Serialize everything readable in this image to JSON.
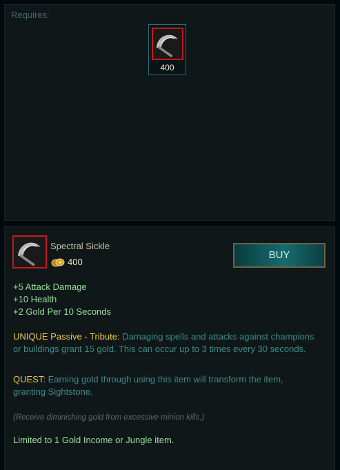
{
  "requires": {
    "label": "Requires:",
    "item": {
      "price": "400"
    }
  },
  "item": {
    "name": "Spectral Sickle",
    "cost": "400",
    "buy_label": "BUY",
    "stats": [
      "+5 Attack Damage",
      "+10 Health",
      "+2 Gold Per 10 Seconds"
    ],
    "unique": {
      "label": "UNIQUE Passive - Tribute:",
      "text": "Damaging spells and attacks against champions or buildings grant 15 gold.  This can occur up to 3 times every 30 seconds."
    },
    "quest": {
      "label": "QUEST:",
      "text": "Earning gold through using this item will transform the item, granting Sightstone."
    },
    "note": "(Receive diminishing gold from excessive minion kills.)",
    "limit": "Limited to 1 Gold Income or Jungle item."
  },
  "icons": {
    "item_icon": "sickle-icon",
    "currency_icon": "gold-coins-icon"
  },
  "colors": {
    "stat_green": "#9be09b",
    "gold": "#f0c644",
    "teal_text": "#3f8a86",
    "item_border_red": "#c31a1a"
  }
}
